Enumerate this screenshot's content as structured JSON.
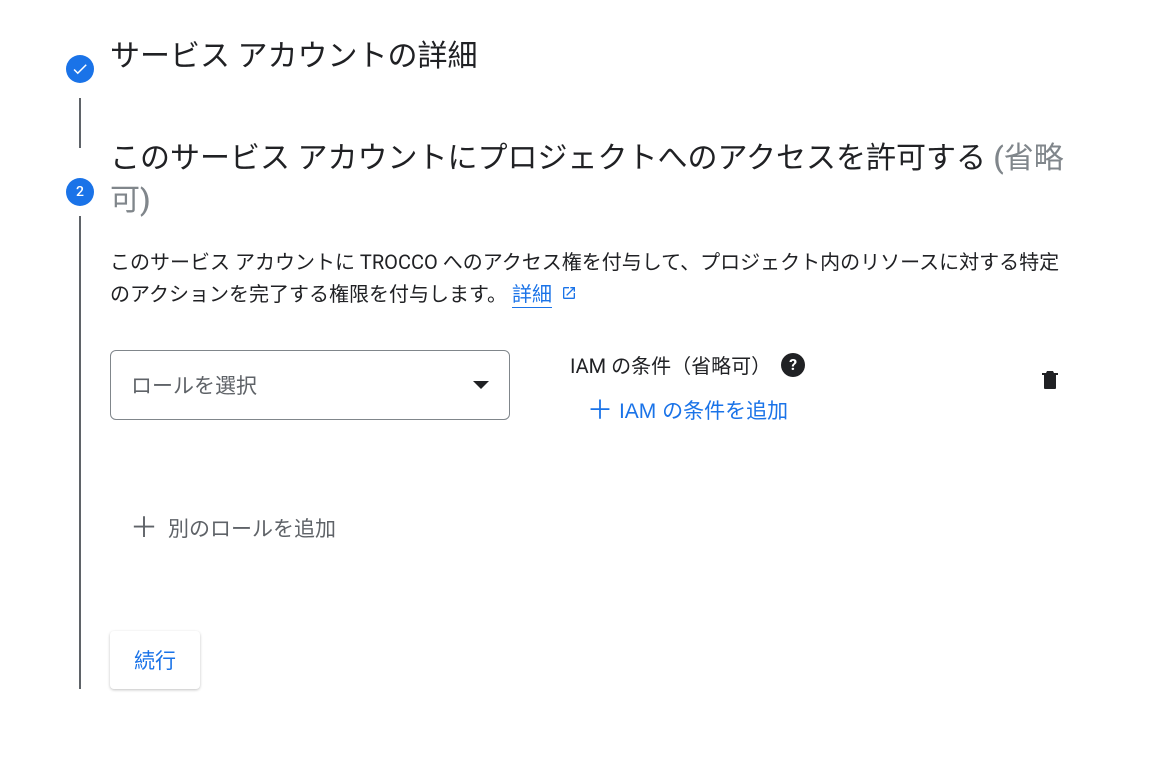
{
  "step1": {
    "title": "サービス アカウントの詳細"
  },
  "step2": {
    "number": "2",
    "title_main": "このサービス アカウントにプロジェクトへのアクセスを許可する ",
    "title_optional": "(省略可)",
    "description_prefix": "このサービス アカウントに TROCCO へのアクセス権を付与して、プロジェクト内のリソースに対する特定のアクションを完了する権限を付与します。 ",
    "more_link": "詳細",
    "role_select_placeholder": "ロールを選択",
    "iam_conditions_label": "IAM の条件（省略可）",
    "add_iam_condition": "IAM の条件を追加",
    "add_another_role": "別のロールを追加",
    "continue_button": "続行"
  }
}
